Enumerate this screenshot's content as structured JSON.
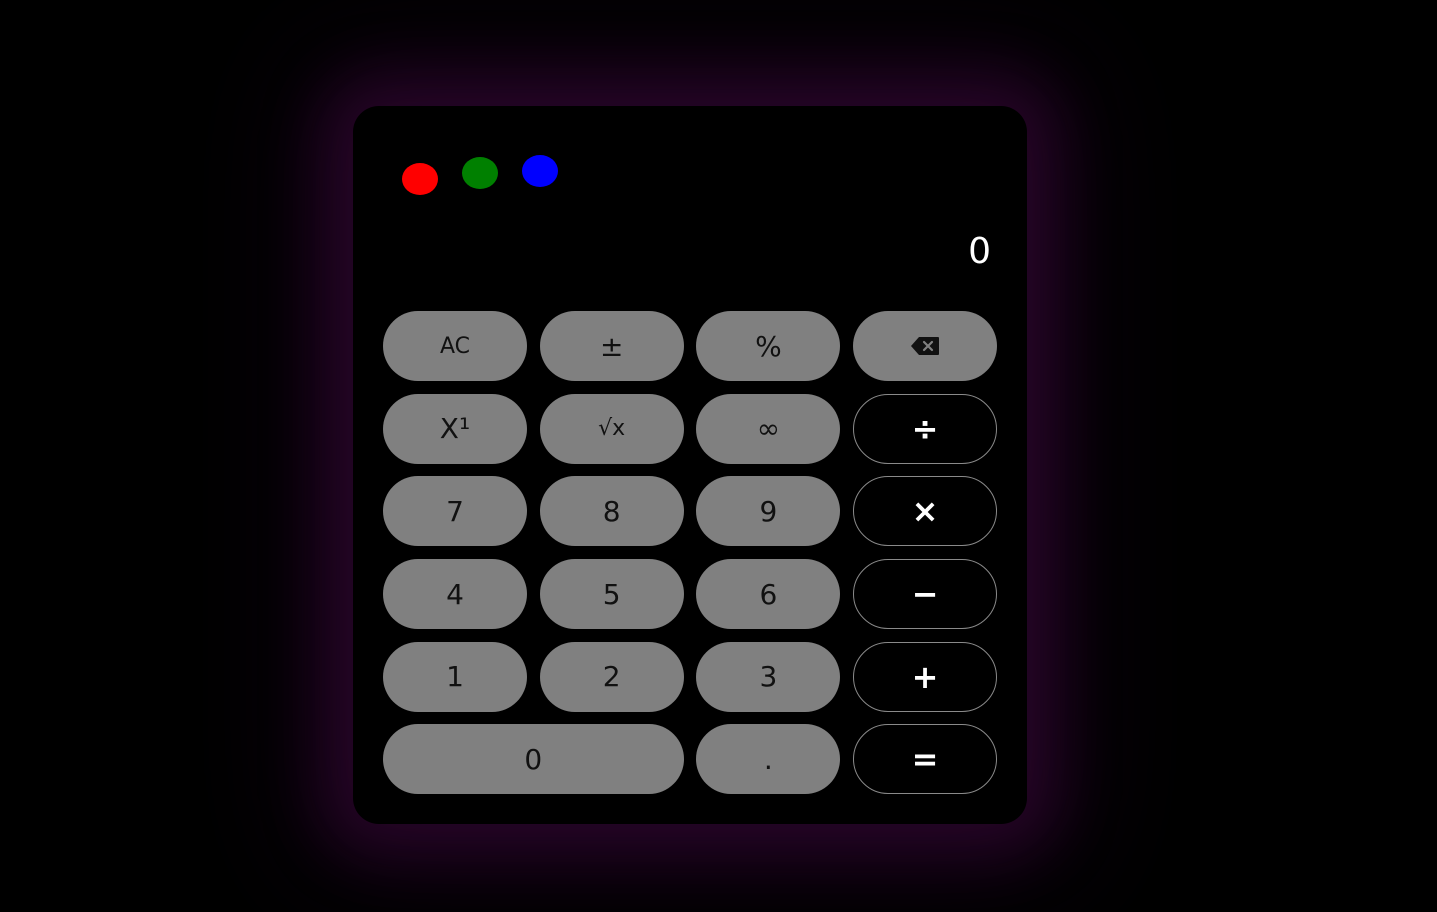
{
  "window_controls": {
    "close_color": "#ff0000",
    "minimize_color": "#008000",
    "maximize_color": "#0000ff"
  },
  "display": {
    "value": "0"
  },
  "keys": {
    "ac": "AC",
    "plus_minus": "±",
    "percent": "%",
    "backspace_icon": "backspace-icon",
    "reciprocal": "X¹",
    "sqrt": "√x",
    "infinity": "∞",
    "divide": "÷",
    "seven": "7",
    "eight": "8",
    "nine": "9",
    "multiply": "×",
    "four": "4",
    "five": "5",
    "six": "6",
    "subtract": "−",
    "one": "1",
    "two": "2",
    "three": "3",
    "add": "+",
    "zero": "0",
    "decimal": ".",
    "equals": "="
  },
  "colors": {
    "background": "#000000",
    "key_gray": "#808080",
    "glow": "#2a0a2e"
  }
}
